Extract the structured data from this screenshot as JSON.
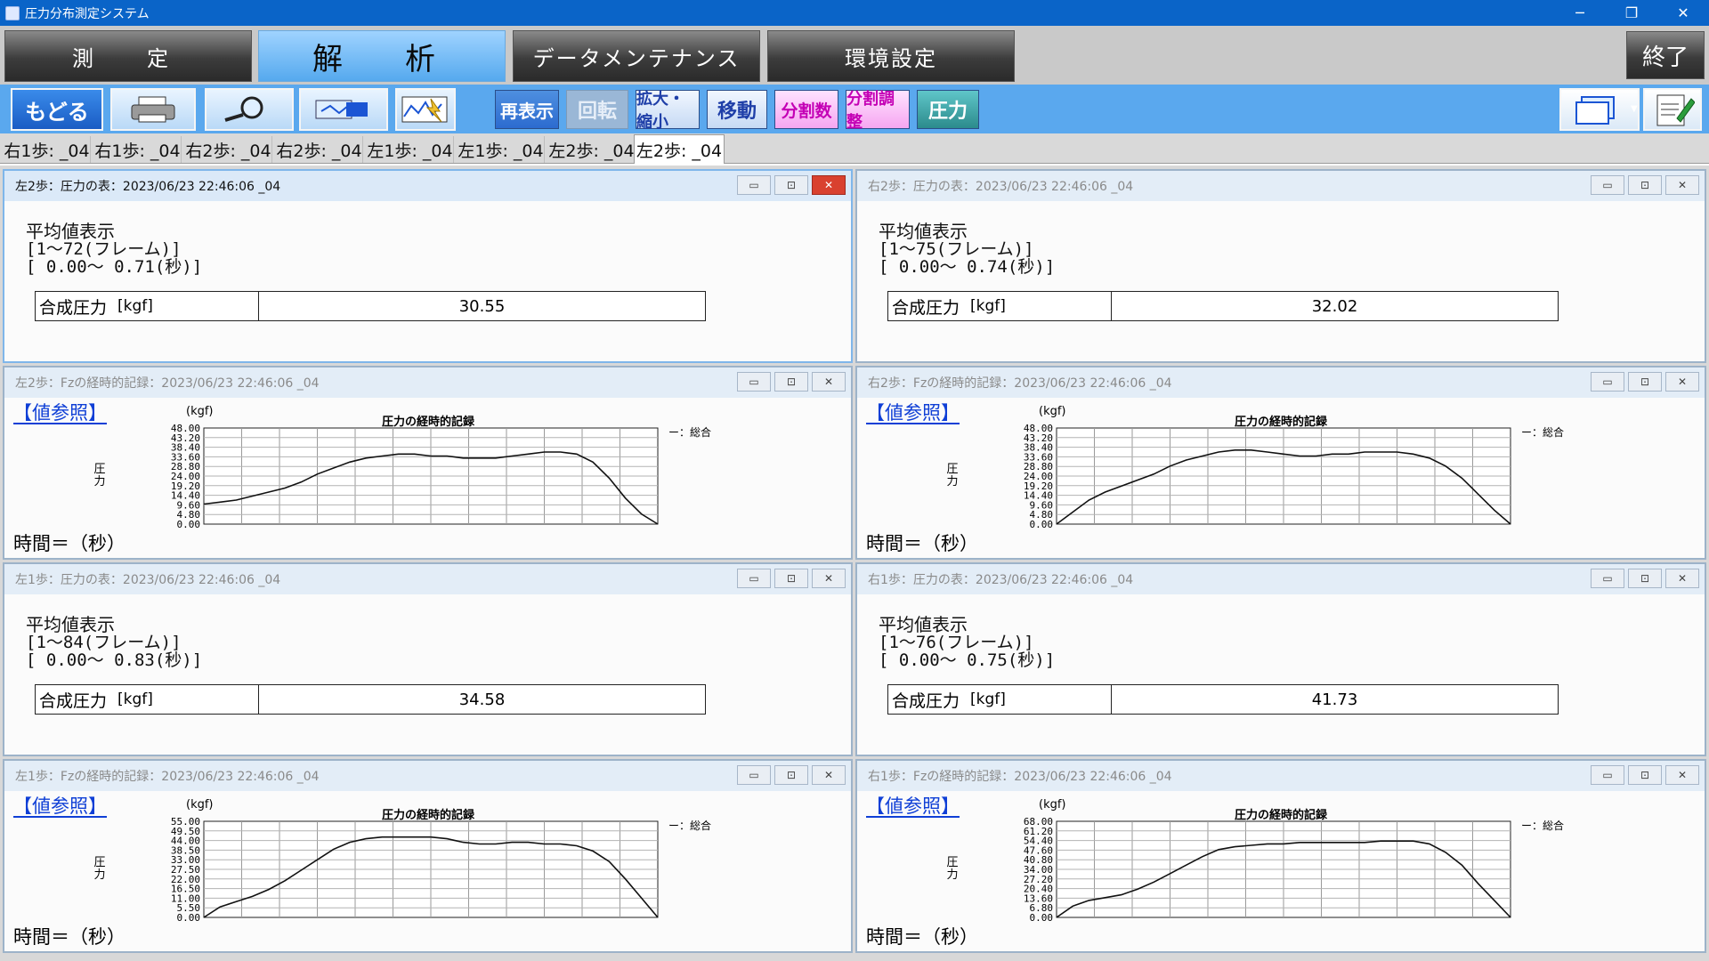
{
  "window": {
    "title": "圧力分布測定システム",
    "minimize": "─",
    "restore": "❐",
    "close": "✕"
  },
  "modes": {
    "measure": "測　定",
    "analyze": "解　析",
    "maintenance": "データメンテナンス",
    "settings": "環境設定",
    "exit": "終了"
  },
  "toolbar": {
    "back": "もどる",
    "redraw": "再表示",
    "rotate": "回転",
    "zoom": "拡大・縮小",
    "move": "移動",
    "div_count": "分割数",
    "div_adjust": "分割調整",
    "pressure": "圧力"
  },
  "data_tabs": [
    "右1歩: _04",
    "右1歩: _04",
    "右2歩: _04",
    "右2歩: _04",
    "左1歩: _04",
    "左1歩: _04",
    "左2歩: _04",
    "左2歩: _04"
  ],
  "labels": {
    "avg_title": "平均値表示",
    "composite": "合成圧力",
    "unit": "[kgf]",
    "ref": "【値参照】",
    "y_unit": "(kgf)",
    "chart_title": "圧力の経時的記録",
    "legend": "ー：総合",
    "y_title": "圧力",
    "time": "時間＝（秒）"
  },
  "panels": {
    "p1": {
      "title": "左2歩：圧力の表：2023/06/23 22:46:06 _04",
      "frames": "[1〜72(フレーム)]",
      "secs": "[ 0.00〜 0.71(秒)]",
      "value": "30.55"
    },
    "p2": {
      "title": "右2歩：圧力の表：2023/06/23 22:46:06 _04",
      "frames": "[1〜75(フレーム)]",
      "secs": "[ 0.00〜 0.74(秒)]",
      "value": "32.02"
    },
    "p3": {
      "title": "左2歩：Fzの経時的記録：2023/06/23 22:46:06 _04"
    },
    "p4": {
      "title": "右2歩：Fzの経時的記録：2023/06/23 22:46:06 _04"
    },
    "p5": {
      "title": "左1歩：圧力の表：2023/06/23 22:46:06 _04",
      "frames": "[1〜84(フレーム)]",
      "secs": "[ 0.00〜 0.83(秒)]",
      "value": "34.58"
    },
    "p6": {
      "title": "右1歩：圧力の表：2023/06/23 22:46:06 _04",
      "frames": "[1〜76(フレーム)]",
      "secs": "[ 0.00〜 0.75(秒)]",
      "value": "41.73"
    },
    "p7": {
      "title": "左1歩：Fzの経時的記録：2023/06/23 22:46:06 _04"
    },
    "p8": {
      "title": "右1歩：Fzの経時的記録：2023/06/23 22:46:06 _04"
    }
  },
  "chart_data": [
    {
      "type": "line",
      "panel": "p3",
      "title": "圧力の経時的記録",
      "ylabel": "圧力",
      "xlabel": "時間＝（秒）",
      "ylim": [
        0,
        48
      ],
      "yticks": [
        "48.00",
        "43.20",
        "38.40",
        "33.60",
        "28.80",
        "24.00",
        "19.20",
        "14.40",
        "9.60",
        "4.80",
        "0.00"
      ],
      "series": [
        {
          "name": "総合",
          "values": [
            10,
            11,
            12,
            14,
            16,
            18,
            21,
            25,
            28,
            31,
            33,
            34,
            35,
            35,
            34,
            34,
            33,
            33,
            33,
            34,
            35,
            36,
            36,
            35,
            31,
            23,
            13,
            5,
            0
          ]
        }
      ]
    },
    {
      "type": "line",
      "panel": "p4",
      "title": "圧力の経時的記録",
      "ylabel": "圧力",
      "xlabel": "時間＝（秒）",
      "ylim": [
        0,
        48
      ],
      "yticks": [
        "48.00",
        "43.20",
        "38.40",
        "33.60",
        "28.80",
        "24.00",
        "19.20",
        "14.40",
        "9.60",
        "4.80",
        "0.00"
      ],
      "series": [
        {
          "name": "総合",
          "values": [
            0,
            6,
            12,
            16,
            19,
            22,
            25,
            29,
            32,
            34,
            36,
            37,
            37,
            36,
            35,
            34,
            34,
            35,
            35,
            36,
            36,
            36,
            35,
            33,
            29,
            23,
            15,
            7,
            0
          ]
        }
      ]
    },
    {
      "type": "line",
      "panel": "p7",
      "title": "圧力の経時的記録",
      "ylabel": "圧力",
      "xlabel": "時間＝（秒）",
      "ylim": [
        0,
        55
      ],
      "yticks": [
        "55.00",
        "49.50",
        "44.00",
        "38.50",
        "33.00",
        "27.50",
        "22.00",
        "16.50",
        "11.00",
        "5.50",
        "0.00"
      ],
      "series": [
        {
          "name": "総合",
          "values": [
            0,
            6,
            9,
            12,
            16,
            21,
            27,
            33,
            39,
            43,
            45,
            46,
            46,
            46,
            46,
            45,
            43,
            42,
            42,
            43,
            43,
            42,
            42,
            41,
            38,
            32,
            22,
            11,
            0
          ]
        }
      ]
    },
    {
      "type": "line",
      "panel": "p8",
      "title": "圧力の経時的記録",
      "ylabel": "圧力",
      "xlabel": "時間＝（秒）",
      "ylim": [
        0,
        68
      ],
      "yticks": [
        "68.00",
        "61.20",
        "54.40",
        "47.60",
        "40.80",
        "34.00",
        "27.20",
        "20.40",
        "13.60",
        "6.80",
        "0.00"
      ],
      "series": [
        {
          "name": "総合",
          "values": [
            0,
            8,
            12,
            14,
            16,
            20,
            25,
            31,
            37,
            43,
            48,
            50,
            51,
            52,
            52,
            53,
            53,
            53,
            53,
            53,
            54,
            54,
            54,
            52,
            46,
            37,
            24,
            12,
            0
          ]
        }
      ]
    }
  ]
}
